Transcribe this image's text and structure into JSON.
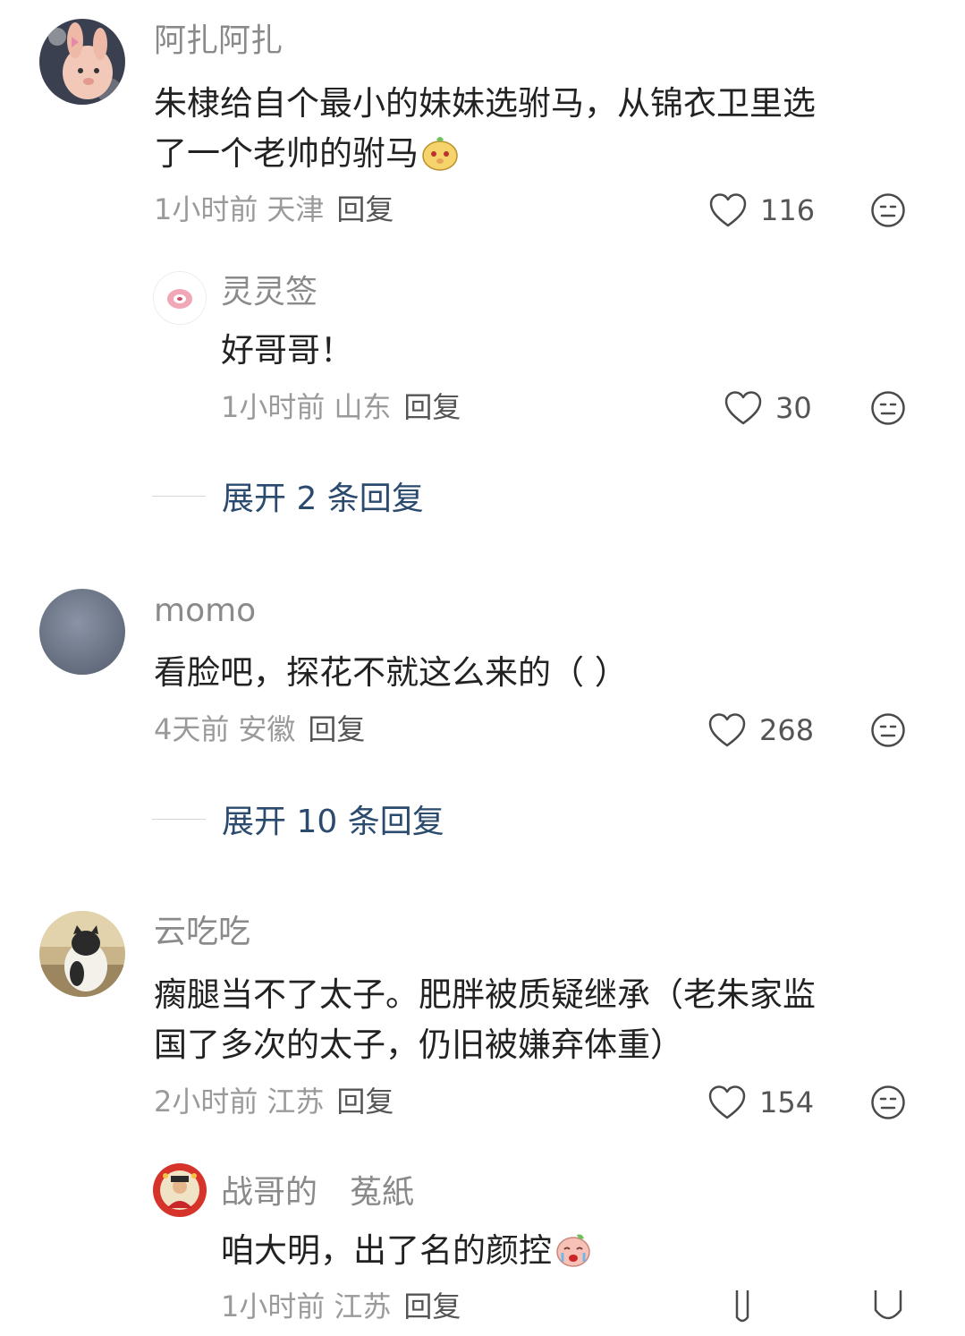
{
  "comments": [
    {
      "user": "阿扎阿扎",
      "text_lines": [
        "朱棣给自个最小的妹妹选驸马，从锦衣卫里选",
        "了一个老帅的驸马"
      ],
      "time": "1小时前",
      "location": "天津",
      "reply_label": "回复",
      "likes": "116",
      "reply": {
        "user": "灵灵签",
        "text": "好哥哥！",
        "time": "1小时前",
        "location": "山东",
        "reply_label": "回复",
        "likes": "30"
      },
      "expand_label": "展开 2 条回复"
    },
    {
      "user": "momo",
      "text_lines": [
        "看脸吧，探花不就这么来的（ ）"
      ],
      "time": "4天前",
      "location": "安徽",
      "reply_label": "回复",
      "likes": "268",
      "expand_label": "展开 10 条回复"
    },
    {
      "user": "云吃吃",
      "text_lines": [
        "瘸腿当不了太子。肥胖被质疑继承（老朱家监",
        "国了多次的太子，仍旧被嫌弃体重）"
      ],
      "time": "2小时前",
      "location": "江苏",
      "reply_label": "回复",
      "likes": "154",
      "reply": {
        "user": "战哥的　菟紙",
        "text": "咱大明，出了名的颜控",
        "time": "1小时前",
        "location": "江苏",
        "reply_label": "回复"
      }
    }
  ],
  "icons": [
    "heart-icon",
    "dislike-face-icon",
    "avatar-image",
    "emoji-sticker"
  ]
}
